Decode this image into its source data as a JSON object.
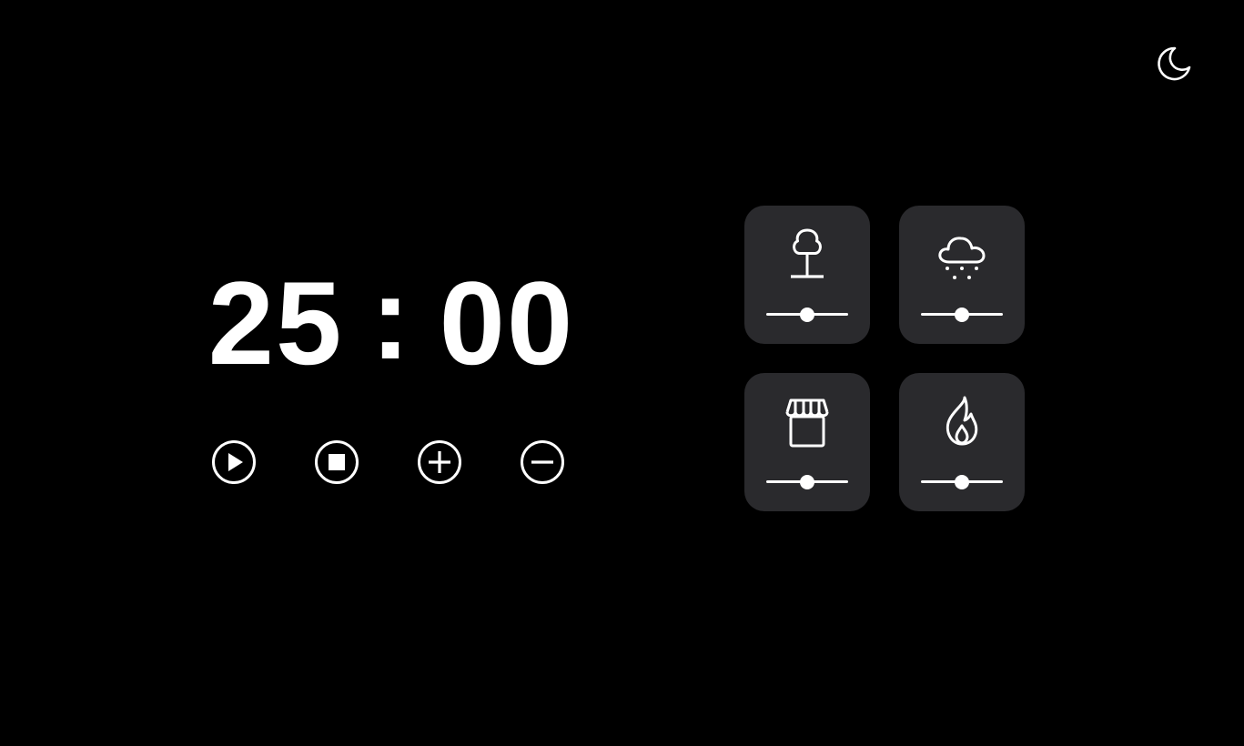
{
  "theme_toggle": {
    "icon": "moon-icon"
  },
  "timer": {
    "minutes": "25",
    "separator": ":",
    "seconds": "00"
  },
  "controls": [
    {
      "name": "play-button",
      "icon": "play-icon"
    },
    {
      "name": "stop-button",
      "icon": "stop-icon"
    },
    {
      "name": "increase-button",
      "icon": "plus-icon"
    },
    {
      "name": "decrease-button",
      "icon": "minus-icon"
    }
  ],
  "sounds": [
    {
      "name": "forest",
      "icon": "tree-icon",
      "volume": 0.5
    },
    {
      "name": "rain",
      "icon": "rain-cloud-icon",
      "volume": 0.5
    },
    {
      "name": "cafe",
      "icon": "storefront-icon",
      "volume": 0.5
    },
    {
      "name": "fireplace",
      "icon": "flame-icon",
      "volume": 0.5
    }
  ],
  "colors": {
    "background": "#000000",
    "card": "#2a2a2d",
    "foreground": "#ffffff"
  }
}
